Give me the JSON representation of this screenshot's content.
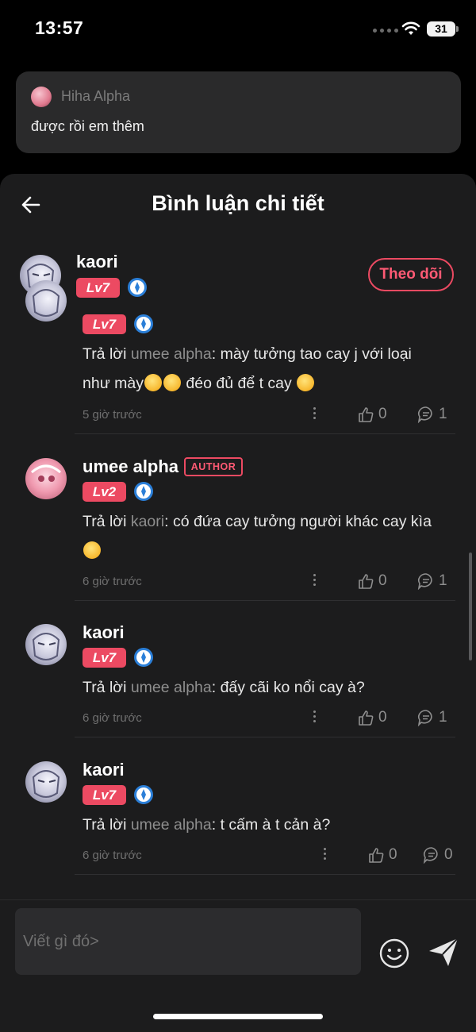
{
  "status_bar": {
    "time": "13:57",
    "battery": "31"
  },
  "notification": {
    "sender": "Hiha Alpha",
    "message": "được rồi em thêm"
  },
  "sheet": {
    "title": "Bình luận chi tiết",
    "main_comment": {
      "username": "kaori",
      "level": "Lv7",
      "follow_label": "Theo dõi"
    }
  },
  "replies": [
    {
      "username": "kaori",
      "level": "Lv7",
      "author_tag": "",
      "reply_prefix": "Trả lời ",
      "reply_to": "umee alpha",
      "text_line1": ": mày tưởng tao cay j với loại",
      "text_line2": "như mày",
      "text_line2_after_emoji": " đéo đủ để t cay ",
      "emoji": "rolling-on-floor-laughing",
      "time": "5 giờ trước",
      "likes": "0",
      "comments": "1"
    },
    {
      "username": "umee alpha",
      "level": "Lv2",
      "author_tag": "AUTHOR",
      "reply_prefix": "Trả lời ",
      "reply_to": "kaori",
      "text": ": có đứa cay tưởng người khác cay kìa",
      "emoji": "rolling-on-floor-laughing",
      "time": "6 giờ trước",
      "likes": "0",
      "comments": "1"
    },
    {
      "username": "kaori",
      "level": "Lv7",
      "author_tag": "",
      "reply_prefix": "Trả lời ",
      "reply_to": "umee alpha",
      "text": ": đấy cãi ko nổi cay à?",
      "time": "6 giờ trước",
      "likes": "0",
      "comments": "1"
    },
    {
      "username": "kaori",
      "level": "Lv7",
      "author_tag": "",
      "reply_prefix": "Trả lời ",
      "reply_to": "umee alpha",
      "text": ": t cấm à t cản à?",
      "time": "6 giờ trước",
      "likes": "0",
      "comments": "0"
    }
  ],
  "composer": {
    "placeholder": "Viết gì đó>"
  },
  "colors": {
    "accent": "#ec4a62",
    "background": "#1c1c1d",
    "mention": "#8e8e8e"
  }
}
